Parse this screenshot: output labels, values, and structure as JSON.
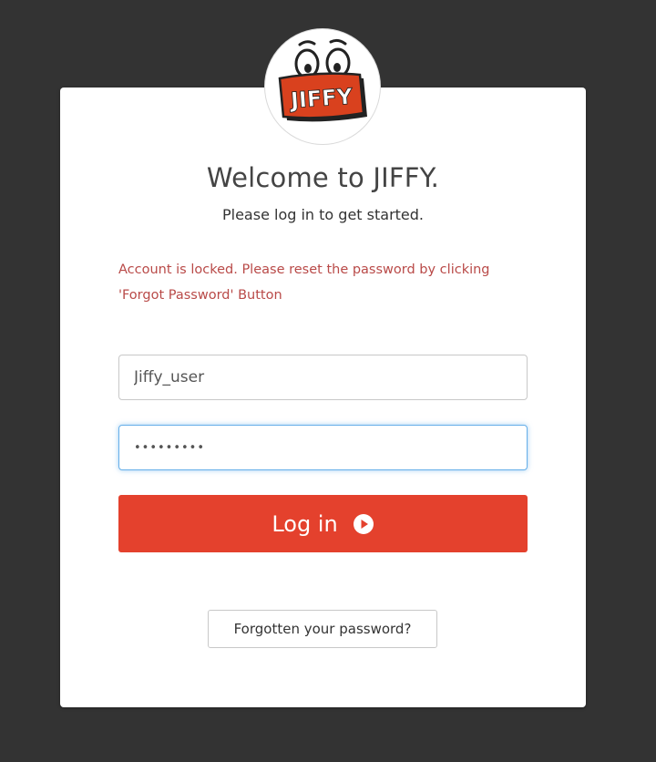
{
  "logo": {
    "text": "JIFFY",
    "icon": "jiffy-mascot-logo",
    "colors": {
      "badge": "#d9411e",
      "outline": "#222222"
    }
  },
  "header": {
    "title": "Welcome to JIFFY.",
    "subtitle": "Please log in to get started."
  },
  "alert": {
    "message": "Account is locked. Please reset the password by clicking 'Forgot Password' Button",
    "color": "#b94a48"
  },
  "form": {
    "username_value": "Jiffy_user",
    "password_value": "abcdefgh1",
    "login_label": "Log in",
    "login_icon": "play-circle-icon",
    "forgot_label": "Forgotten your password?"
  },
  "colors": {
    "background": "#333333",
    "accent": "#e4412d",
    "focus": "#66afe9"
  }
}
